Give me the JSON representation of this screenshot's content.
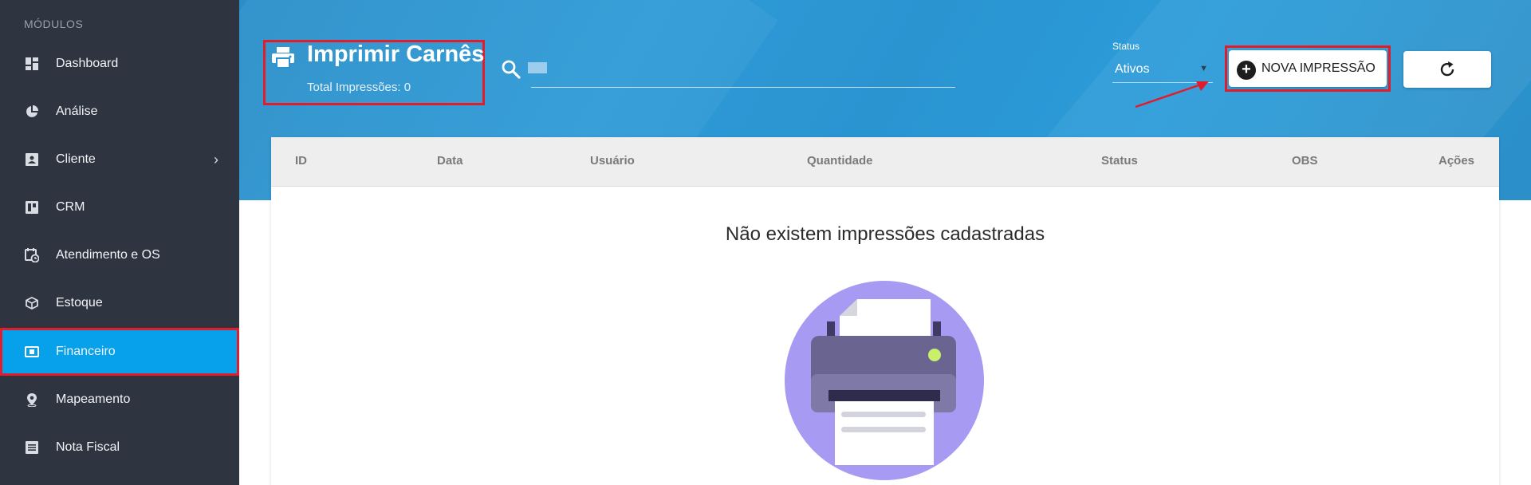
{
  "sidebar": {
    "heading": "MÓDULOS",
    "items": [
      {
        "label": "Dashboard",
        "icon": "dashboard-icon"
      },
      {
        "label": "Análise",
        "icon": "pie-chart-icon"
      },
      {
        "label": "Cliente",
        "icon": "contact-card-icon",
        "has_submenu": true
      },
      {
        "label": "CRM",
        "icon": "kanban-board-icon"
      },
      {
        "label": "Atendimento e OS",
        "icon": "calendar-clock-icon"
      },
      {
        "label": "Estoque",
        "icon": "box-icon"
      },
      {
        "label": "Financeiro",
        "icon": "money-icon",
        "active": true
      },
      {
        "label": "Mapeamento",
        "icon": "map-pin-icon"
      },
      {
        "label": "Nota Fiscal",
        "icon": "receipt-icon"
      }
    ],
    "submenu_chevron": "›"
  },
  "header": {
    "title": "Imprimir Carnês",
    "subtitle": "Total Impressões: 0",
    "search": {
      "placeholder": "",
      "value": ""
    },
    "status": {
      "label": "Status",
      "selected": "Ativos"
    },
    "new_button_label": "NOVA IMPRESSÃO"
  },
  "table": {
    "columns": [
      "ID",
      "Data",
      "Usuário",
      "Quantidade",
      "Status",
      "OBS",
      "Ações"
    ],
    "empty_message": "Não existem impressões cadastradas"
  },
  "colors": {
    "sidebar_bg": "#2e3440",
    "active_item": "#07a0ea",
    "header_bg": "#2b94d0",
    "highlight_red": "#e21c2a",
    "illustration_circle": "#a79af2"
  }
}
